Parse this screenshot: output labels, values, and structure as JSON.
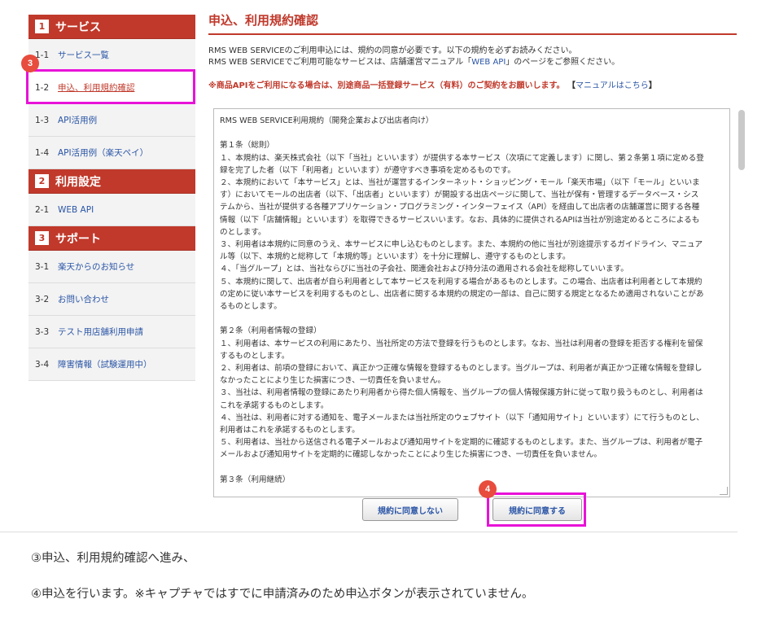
{
  "sidebar": {
    "sections": [
      {
        "num": "1",
        "title": "サービス",
        "items": [
          {
            "num": "1-1",
            "label": "サービス一覧"
          },
          {
            "num": "1-2",
            "label": "申込、利用規約確認"
          },
          {
            "num": "1-3",
            "label": "API活用例"
          },
          {
            "num": "1-4",
            "label": "API活用例（楽天ペイ）"
          }
        ]
      },
      {
        "num": "2",
        "title": "利用設定",
        "items": [
          {
            "num": "2-1",
            "label": "WEB API"
          }
        ]
      },
      {
        "num": "3",
        "title": "サポート",
        "items": [
          {
            "num": "3-1",
            "label": "楽天からのお知らせ"
          },
          {
            "num": "3-2",
            "label": "お問い合わせ"
          },
          {
            "num": "3-3",
            "label": "テスト用店舗利用申請"
          },
          {
            "num": "3-4",
            "label": "障害情報（試験運用中）"
          }
        ]
      }
    ]
  },
  "badges": {
    "step3": "3",
    "step4": "4"
  },
  "main": {
    "title": "申込、利用規約確認",
    "intro_line1": "RMS WEB SERVICEのご利用申込には、規約の同意が必要です。以下の規約を必ずお読みください。",
    "intro_line2_pre": "RMS WEB SERVICEでご利用可能なサービスは、店舗運営マニュアル「",
    "intro_line2_link": "WEB API",
    "intro_line2_post": "」のページをご参照ください。",
    "notice": "※商品APIをご利用になる場合は、別途商品一括登録サービス（有料）のご契約をお願いします。",
    "notice_paren_open": "【",
    "notice_manual": "マニュアルはこちら",
    "notice_paren_close": "】",
    "terms_text": "RMS WEB SERVICE利用規約（開発企業および出店者向け）\n\n第１条（総則）\n１、本規約は、楽天株式会社（以下「当社」といいます）が提供する本サービス（次項にて定義します）に関し、第２条第１項に定める登録を完了した者（以下「利用者」といいます）が遵守すべき事項を定めるものです。\n２、本規約において「本サービス」とは、当社が運営するインターネット・ショッピング・モール「楽天市場」（以下「モール」といいます）においてモールの出店者（以下、「出店者」といいます）が開設する出店ページに関して、当社が保有・管理するデータベース・システムから、当社が提供する各種アプリケーション・プログラミング・インターフェイス（API）を経由して出店者の店舗運営に関する各種情報（以下「店舗情報」といいます）を取得できるサービスいいます。なお、具体的に提供されるAPIは当社が別途定めるところによるものとします。\n３、利用者は本規約に同意のうえ、本サービスに申し込むものとします。また、本規約の他に当社が別途提示するガイドライン、マニュアル等（以下、本規約と総称して「本規約等」といいます）を十分に理解し、遵守するものとします。\n４、「当グループ」とは、当社ならびに当社の子会社、関連会社および持分法の適用される会社を総称していいます。\n５、本規約に関して、出店者が自ら利用者として本サービスを利用する場合があるものとします。この場合、出店者は利用者として本規約の定めに従い本サービスを利用するものとし、出店者に関する本規約の規定の一部は、自己に関する規定となるため適用されないことがあるものとします。\n\n第２条（利用者情報の登録）\n１、利用者は、本サービスの利用にあたり、当社所定の方法で登録を行うものとします。なお、当社は利用者の登録を拒否する権利を留保するものとします。\n２、利用者は、前項の登録において、真正かつ正確な情報を登録するものとします。当グループは、利用者が真正かつ正確な情報を登録しなかったことにより生じた損害につき、一切責任を負いません。\n３、当社は、利用者情報の登録にあたり利用者から得た個人情報を、当グループの個人情報保護方針に従って取り扱うものとし、利用者はこれを承諾するものとします。\n４、当社は、利用者に対する通知を、電子メールまたは当社所定のウェブサイト（以下「通知用サイト」といいます）にて行うものとし、利用者はこれを承諾するものとします。\n５、利用者は、当社から送信される電子メールおよび通知用サイトを定期的に確認するものとします。また、当グループは、利用者が電子メールおよび通知用サイトを定期的に確認しなかったことにより生じた損害につき、一切責任を負いません。\n\n第３条（利用継続）",
    "btn_disagree": "規約に同意しない",
    "btn_agree": "規約に同意する"
  },
  "captions": {
    "line1": "③申込、利用規約確認へ進み、",
    "line2": "④申込を行います。※キャプチャではすでに申請済みのため申込ボタンが表示されていません。"
  },
  "colors": {
    "accent": "#c0392b",
    "link": "#2a55a6",
    "highlight": "#e812d8",
    "badge": "#e74c3c"
  }
}
